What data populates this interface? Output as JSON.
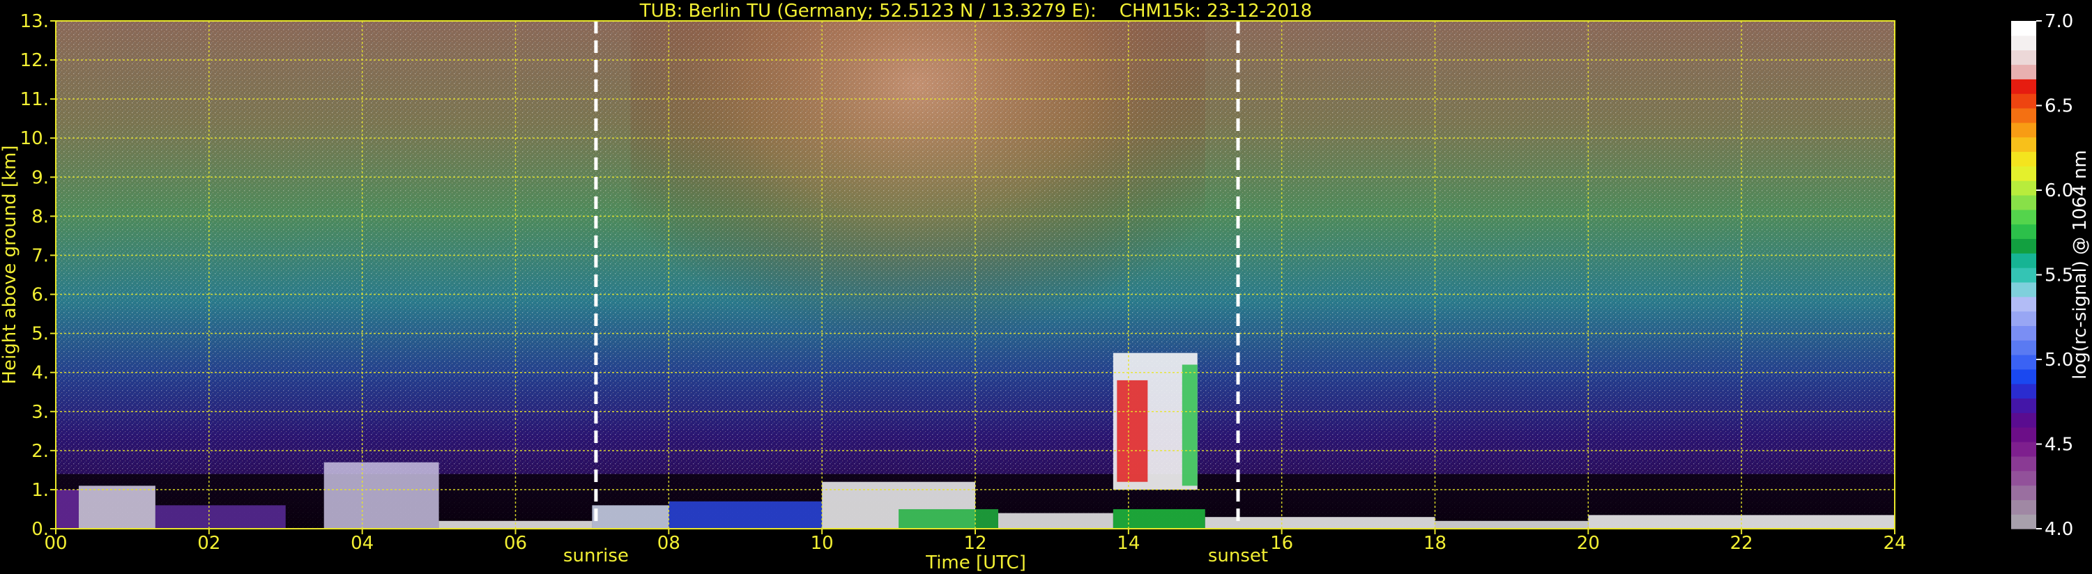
{
  "chart_data": {
    "type": "heatmap",
    "title": "TUB: Berlin TU (Germany; 52.5123 N / 13.3279 E):    CHM15k: 23-12-2018",
    "xlabel": "Time [UTC]",
    "ylabel": "Height above ground [km]",
    "xlim": [
      0,
      24
    ],
    "ylim": [
      0,
      13
    ],
    "x_ticks": [
      "00",
      "02",
      "04",
      "06",
      "08",
      "10",
      "12",
      "14",
      "16",
      "18",
      "20",
      "22",
      "24"
    ],
    "y_ticks": [
      "0.",
      "1.",
      "2.",
      "3.",
      "4.",
      "5.",
      "6.",
      "7.",
      "8.",
      "9.",
      "10.",
      "11.",
      "12.",
      "13."
    ],
    "grid": true,
    "markers": [
      {
        "label": "sunrise",
        "x": 7.05
      },
      {
        "label": "sunset",
        "x": 15.43
      }
    ],
    "colorbar": {
      "label": "log(rc-signal) @ 1064 nm",
      "range": [
        4.0,
        7.0
      ],
      "ticks": [
        "4.0",
        "4.5",
        "5.0",
        "5.5",
        "6.0",
        "6.5",
        "7.0"
      ],
      "colors": [
        "#a8a0ac",
        "#a088a4",
        "#9a6fa0",
        "#92519a",
        "#8a3a94",
        "#7e1f8e",
        "#6c0e88",
        "#5a0c90",
        "#4416a8",
        "#2a2cd0",
        "#1a48f0",
        "#3a62f4",
        "#5a7af2",
        "#7a8ef4",
        "#98a6f4",
        "#b2bcf6",
        "#7fd0dc",
        "#34c4b4",
        "#16b494",
        "#12a040",
        "#2cc04a",
        "#54d44c",
        "#88e048",
        "#b8ec3c",
        "#e4f02c",
        "#f4e41e",
        "#f8c01a",
        "#f89c14",
        "#f47012",
        "#ee4410",
        "#e61c10",
        "#e8b0b0",
        "#ecd8d8",
        "#f4f0f0",
        "#ffffff"
      ]
    },
    "features": [
      {
        "description": "near-surface aerosol layer",
        "x_range": [
          0,
          24
        ],
        "height_km": [
          0,
          1.3
        ]
      },
      {
        "description": "low clouds",
        "x_range": [
          13.8,
          14.9
        ],
        "height_km": [
          1.0,
          4.5
        ]
      }
    ]
  }
}
